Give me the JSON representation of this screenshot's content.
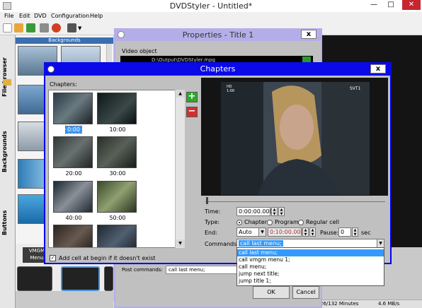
{
  "main_window": {
    "title": "DVDStyler - Untitled*",
    "minimize": "—",
    "maximize": "□",
    "close": "✕"
  },
  "menubar": [
    "File",
    "Edit",
    "DVD",
    "Configuration",
    "Help"
  ],
  "toolbar_icons": [
    "new-file-icon",
    "open-folder-icon",
    "add-file-icon",
    "settings-wrench-icon",
    "burn-disc-icon",
    "add-menu-icon"
  ],
  "side_tabs": [
    "File browser",
    "Backgrounds",
    "Buttons"
  ],
  "backgrounds_header": "Backgrounds",
  "menus_strip": {
    "vmgm_label": "VMGM",
    "menu_label": "Menu"
  },
  "status": {
    "minutes": "26/132 Minutes",
    "rate": "4.6 MB/s"
  },
  "properties": {
    "title": "Properties - Title 1",
    "close": "x",
    "video_object_label": "Video object",
    "video_object_value": "D:\\Output\\DVDStyler.mpg",
    "post_commands_label": "Post commands:",
    "post_commands_value": "call last menu;",
    "ok": "OK",
    "cancel": "Cancel"
  },
  "chapters": {
    "title": "Chapters",
    "close": "x",
    "list_label": "Chapters:",
    "items": [
      {
        "label": "0:00",
        "selected": true
      },
      {
        "label": "10:00",
        "selected": false
      },
      {
        "label": "20:00",
        "selected": false
      },
      {
        "label": "30:00",
        "selected": false
      },
      {
        "label": "40:00",
        "selected": false
      },
      {
        "label": "50:00",
        "selected": false
      },
      {
        "label": "",
        "selected": false
      },
      {
        "label": "",
        "selected": false
      }
    ],
    "add_button": "+",
    "remove_button": "−",
    "add_cell_checked": true,
    "add_cell_label": "Add cell at begin if it doesn't exist",
    "preview_osd_left": "HD\n1:00",
    "preview_osd_right": "SVT1",
    "time_label": "Time:",
    "time_value": "0:00:00.000",
    "type_label": "Type:",
    "type_options": [
      "Chapter",
      "Program",
      "Regular cell"
    ],
    "type_selected": "Chapter",
    "end_label": "End:",
    "end_mode": "Auto",
    "end_value": "0:10:00.000",
    "pause_label": "Pause:",
    "pause_value": "0",
    "pause_unit": "sec",
    "commands_label": "Commands:",
    "commands_value": "call last menu;",
    "commands_options": [
      "call last menu;",
      "call vmgm menu 1;",
      "call menu;",
      "jump next title;",
      "jump title 1;"
    ]
  }
}
